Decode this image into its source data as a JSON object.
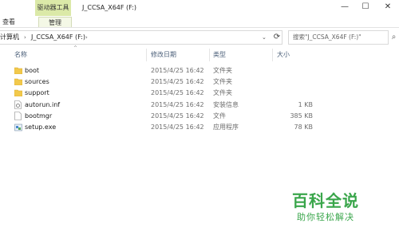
{
  "ribbon": {
    "context_tab": "驱动器工具",
    "window_title": "J_CCSA_X64F (F:)",
    "tab_view": "查看",
    "tab_manage": "管理",
    "minimize": "—",
    "maximize": "☐",
    "close": "✕"
  },
  "address": {
    "computer": "计算机",
    "drive": "J_CCSA_X64F (F:)",
    "search_placeholder": "搜索\"J_CCSA_X64F (F:)\""
  },
  "columns": {
    "name": "名称",
    "modified": "修改日期",
    "type": "类型",
    "size": "大小"
  },
  "files": [
    {
      "name": "boot",
      "modified": "2015/4/25 16:42",
      "type": "文件夹",
      "size": "",
      "icon": "folder-icon"
    },
    {
      "name": "sources",
      "modified": "2015/4/25 16:42",
      "type": "文件夹",
      "size": "",
      "icon": "folder-icon"
    },
    {
      "name": "support",
      "modified": "2015/4/25 16:42",
      "type": "文件夹",
      "size": "",
      "icon": "folder-icon"
    },
    {
      "name": "autorun.inf",
      "modified": "2015/4/25 16:42",
      "type": "安装信息",
      "size": "1 KB",
      "icon": "setup-info-icon"
    },
    {
      "name": "bootmgr",
      "modified": "2015/4/25 16:42",
      "type": "文件",
      "size": "385 KB",
      "icon": "file-icon"
    },
    {
      "name": "setup.exe",
      "modified": "2015/4/25 16:42",
      "type": "应用程序",
      "size": "78 KB",
      "icon": "exe-icon"
    }
  ],
  "watermark": {
    "title": "百科全说",
    "subtitle": "助你轻松解决"
  },
  "colors": {
    "context_tab": "#dbe9a8",
    "folder": "#f2c94c",
    "watermark": "#3aa64b"
  }
}
